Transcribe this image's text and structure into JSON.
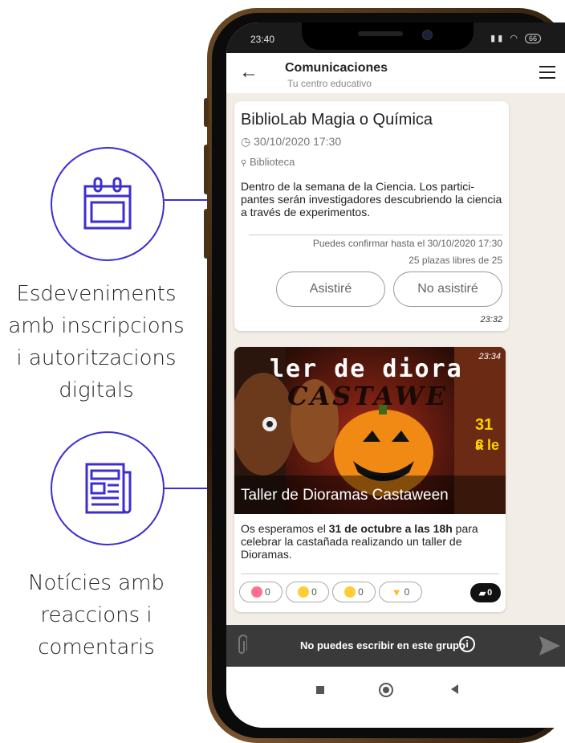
{
  "promo": {
    "events_text": [
      "Esdeveniments",
      "amb inscripcions",
      "i autoritzacions",
      "digitals"
    ],
    "news_text": [
      "Notícies amb",
      "reaccions i",
      "comentaris"
    ],
    "accent_color": "#3d2ed1"
  },
  "status": {
    "time": "23:40",
    "battery": "66"
  },
  "appbar": {
    "title": "Comunicaciones",
    "subtitle": "Tu centro educativo"
  },
  "event": {
    "title": "BiblioLab Magia o Química",
    "date": "30/10/2020 17:30",
    "place": "Biblioteca",
    "description": "Dentro de la semana de la Ciencia. Los partici- pantes serán investigadores descubriendo la ciencia a través de experimentos.",
    "confirm_until": "Puedes confirmar hasta el 30/10/2020 17:30",
    "seats": "25 plazas libres de 25",
    "attend_label": "Asistiré",
    "not_attend_label": "No asistiré",
    "time": "23:32"
  },
  "news": {
    "time": "23:34",
    "image_text_line1": "ler de diora",
    "image_text_line2": "CASTAWE",
    "image_side_text": "31 c",
    "image_side_text2": "a le",
    "caption": "Taller de Dioramas Castaween",
    "body_pre": "Os esperamos el ",
    "body_bold": "31 de octubre a las 18h",
    "body_post": " para celebrar la castañada realizando un taller de Dioramas.",
    "reactions": [
      {
        "name": "love",
        "count": "0",
        "color": "#ff6f91"
      },
      {
        "name": "laugh",
        "count": "0",
        "color": "#ffcc33"
      },
      {
        "name": "sad",
        "count": "0",
        "color": "#ffcc33"
      },
      {
        "name": "dislike",
        "count": "0",
        "color": "#ffbb22"
      }
    ],
    "comments": "0"
  },
  "bottom": {
    "no_write": "No puedes escribir en este grupo"
  }
}
